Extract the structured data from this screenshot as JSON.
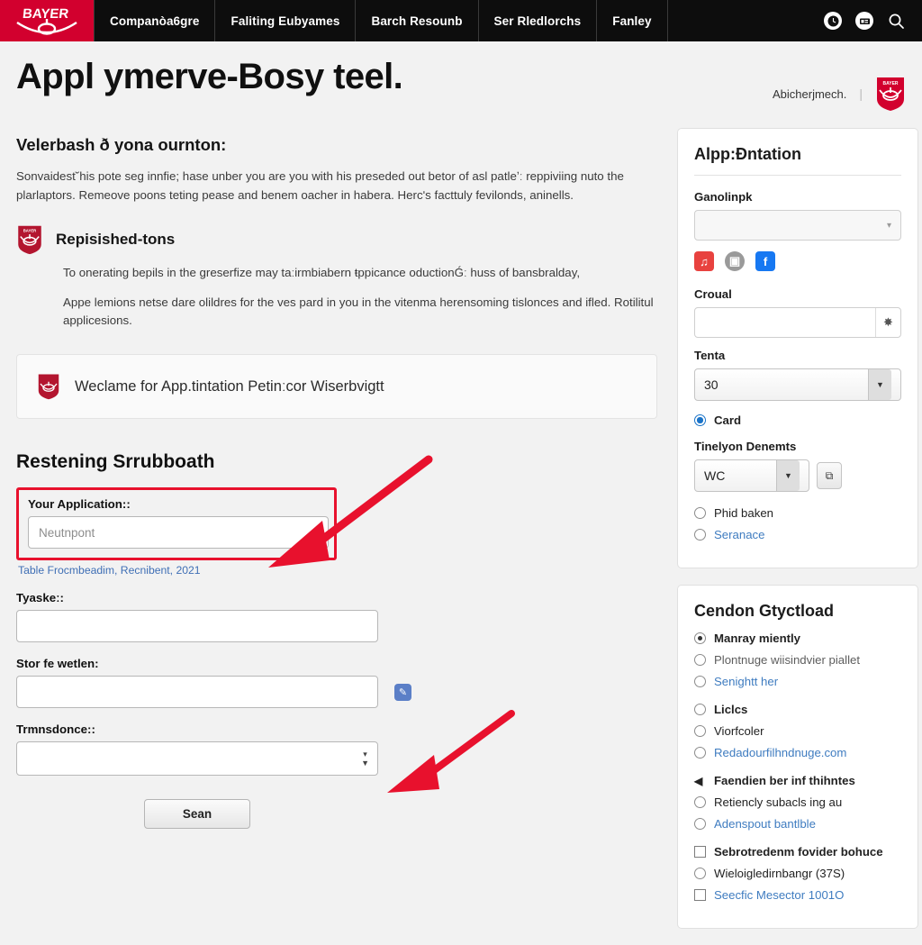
{
  "nav": {
    "logo_text": "BAYER",
    "logo_name": "bayer-logo",
    "items": [
      {
        "label": "Companòa6gre"
      },
      {
        "label": "Faliting Eubyames"
      },
      {
        "label": "Barch Resounb"
      },
      {
        "label": "Ser Rledlorchs"
      },
      {
        "label": "Fanley"
      }
    ],
    "right_icons": [
      {
        "name": "clock-icon",
        "glyph": "◕"
      },
      {
        "name": "media-icon",
        "glyph": "▤"
      },
      {
        "name": "search-icon",
        "glyph": "⌕"
      }
    ]
  },
  "header": {
    "title": "Appl ymerve-Bosy teel.",
    "user_label": "Abicherjmech.",
    "separator": "|",
    "crest_name": "bayer-crest"
  },
  "main": {
    "section_title": "Velerbash ð yona ournton:",
    "intro_paragraph": "Sonvaidest˘his pote seg innfie; hase unber you are you with his preseded out betor of asl patleʼː reppiviing nuto the plarlaptors. Remeove poons teting pease and benem oacher in habera. Hercʹs facttuly fevilonds, aninells.",
    "subsection": {
      "heading": "Repisished-tons",
      "paragraphs": [
        "To onerating bepils in the greserfize may taːirmbiabern ŧppicance oductionǴː huss of bansbralday,",
        "Appe lemions netse dare olildres for the ves pard in you in the vitenma herensoming tislonces and ifled. Rotilitul applicesions."
      ]
    },
    "notice": {
      "icon_name": "bayer-crest-small",
      "text": "Weclame for  App.tintation Petinːcor Wiserbvigtt"
    },
    "form": {
      "title": "Restening Srrubboath",
      "fields": [
        {
          "label": "Your Application::",
          "placeholder": "Neutnpont",
          "value": "",
          "highlighted": true,
          "caption": "Table Frocmbeadim, Recnibent, 2021"
        },
        {
          "label": "Tyaskeː:",
          "placeholder": "",
          "value": "",
          "highlighted": false
        },
        {
          "label": "Stor fe wetlen:",
          "placeholder": "",
          "value": "",
          "highlighted": false,
          "side_button": "✎"
        },
        {
          "label": "Trmnsdonce::",
          "placeholder": "",
          "value": "",
          "is_select": true
        }
      ],
      "submit_label": "Sean"
    }
  },
  "sidebar": {
    "panel_one": {
      "title": "Alpp:Ɖntation",
      "group_label": "Ganolinpk",
      "dropdown_value": "",
      "dropdown_caret": "▾",
      "social": [
        {
          "name": "music-icon",
          "glyph": "♫",
          "color": "#e8423f"
        },
        {
          "name": "camera-icon",
          "glyph": "▣",
          "color": "#9a9a9a"
        },
        {
          "name": "facebook-icon",
          "glyph": "f",
          "color": "#1778f2"
        }
      ],
      "crowal_label": "Croual",
      "crowal_value": "",
      "crowal_button_glyph": "✸",
      "tenta_label": "Tenta",
      "tenta_value": "30",
      "card_option": {
        "label": "Card",
        "selected": true
      },
      "tinelyon_label": "Tinelyon Denemts",
      "tinelyon_value": "WC",
      "tinelyon_button_glyph": "⧉",
      "options": [
        {
          "label": "Phid baken",
          "type": "radio",
          "selected": false,
          "style": "normal"
        },
        {
          "label": "Seranace",
          "type": "radio",
          "selected": false,
          "style": "link"
        }
      ]
    },
    "panel_two": {
      "title": "Cendon Gtyctload",
      "groups": [
        {
          "options": [
            {
              "label": "Manray miently",
              "type": "radio",
              "selected": true,
              "style": "strong"
            },
            {
              "label": "Plontnuge wiisindvier piallet",
              "type": "radio",
              "selected": false,
              "style": "muted"
            },
            {
              "label": "Senightt her",
              "type": "radio",
              "selected": false,
              "style": "link"
            }
          ]
        },
        {
          "options": [
            {
              "label": "Liclcs",
              "type": "radio",
              "selected": false,
              "style": "strong"
            },
            {
              "label": "Viorfcoler",
              "type": "radio",
              "selected": false,
              "style": "normal"
            },
            {
              "label": "Redadourfilhndnuge.com",
              "type": "radio",
              "selected": false,
              "style": "link"
            }
          ]
        },
        {
          "options": [
            {
              "label": "Faendien ber inf thihntes",
              "type": "flag",
              "selected": false,
              "style": "strong"
            },
            {
              "label": "Retiencly subacls ing au",
              "type": "radio",
              "selected": false,
              "style": "normal"
            },
            {
              "label": "Adenspout bantlble",
              "type": "radio",
              "selected": false,
              "style": "link"
            }
          ]
        },
        {
          "options": [
            {
              "label": "Sebrotredenm fovider bohuce",
              "type": "checkbox",
              "selected": false,
              "style": "strong"
            },
            {
              "label": "Wieloigledirnbangr (37S)",
              "type": "radio",
              "selected": false,
              "style": "normal"
            },
            {
              "label": "Seecfic Mesector 1001O",
              "type": "checkbox",
              "selected": false,
              "style": "link"
            }
          ]
        }
      ]
    }
  },
  "annotations": {
    "arrow_color": "#e8112d",
    "arrow_one_name": "annotation-arrow-to-application-field",
    "arrow_two_name": "annotation-arrow-to-edit-button"
  }
}
